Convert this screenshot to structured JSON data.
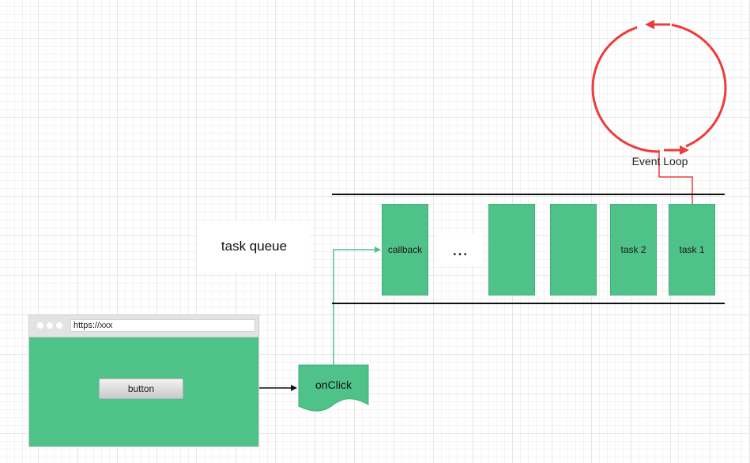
{
  "colors": {
    "task_fill": "#4fc28a",
    "loop_stroke": "#ee3b3b",
    "connector": "#4fc28a",
    "queue_border": "#111111"
  },
  "queue": {
    "label": "task queue",
    "ellipsis": "...",
    "slots": [
      {
        "label": "callback"
      },
      {
        "label": ""
      },
      {
        "label": ""
      },
      {
        "label": "task 2"
      },
      {
        "label": "task 1"
      }
    ]
  },
  "browser": {
    "url": "https://xxx",
    "button_label": "button"
  },
  "onclick": {
    "label": "onClick"
  },
  "event_loop": {
    "label": "Event Loop"
  }
}
